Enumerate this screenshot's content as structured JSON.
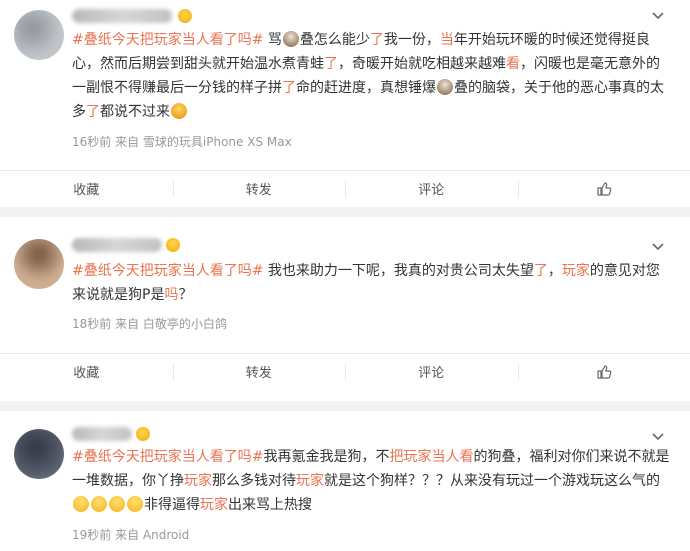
{
  "posts": [
    {
      "content_parts": [
        {
          "t": "#叠纸今天把玩家当人看了吗#",
          "hl": true
        },
        {
          "t": " 骂",
          "hl": false
        },
        {
          "emoji": "face"
        },
        {
          "t": "叠怎么能少",
          "hl": false
        },
        {
          "t": "了",
          "hl": true
        },
        {
          "t": "我一份，",
          "hl": false
        },
        {
          "t": "当",
          "hl": true
        },
        {
          "t": "年开始玩环暖的时候还觉得挺良心，然而后期尝到甜头就开始温水煮青蛙",
          "hl": false
        },
        {
          "t": "了",
          "hl": true
        },
        {
          "t": "，奇暖开始就吃相越来越难",
          "hl": false
        },
        {
          "t": "看",
          "hl": true
        },
        {
          "t": "，闪暖也是毫无意外的一副恨不得赚最后一分钱的样子拼",
          "hl": false
        },
        {
          "t": "了",
          "hl": true
        },
        {
          "t": "命的赶进度，真想锤爆",
          "hl": false
        },
        {
          "emoji": "face"
        },
        {
          "t": "叠的脑袋，关于他的恶心事真的太多",
          "hl": false
        },
        {
          "t": "了",
          "hl": true
        },
        {
          "t": "都说不过来",
          "hl": false
        },
        {
          "emoji": "angry"
        }
      ],
      "meta": "16秒前  来自 雪球的玩具iPhone XS Max"
    },
    {
      "content_parts": [
        {
          "t": "#叠纸今天把玩家当人看了吗#",
          "hl": true
        },
        {
          "t": " 我也来助力一下呢，我真的对贵公司太失望",
          "hl": false
        },
        {
          "t": "了",
          "hl": true
        },
        {
          "t": "，",
          "hl": false
        },
        {
          "t": "玩家",
          "hl": true
        },
        {
          "t": "的意见对您来说就是狗P是",
          "hl": false
        },
        {
          "t": "吗",
          "hl": true
        },
        {
          "t": "？",
          "hl": false
        }
      ],
      "meta": "18秒前  来自 白敬亭的小白鸽"
    },
    {
      "content_parts": [
        {
          "t": "#叠纸今天把玩家当人看了吗#",
          "hl": true
        },
        {
          "t": "我再氪金我是狗，不",
          "hl": false
        },
        {
          "t": "把玩家当人看",
          "hl": true
        },
        {
          "t": "的狗叠，福利对你们来说不就是一堆数据，你丫挣",
          "hl": false
        },
        {
          "t": "玩家",
          "hl": true
        },
        {
          "t": "那么多钱对待",
          "hl": false
        },
        {
          "t": "玩家",
          "hl": true
        },
        {
          "t": "就是这个狗样？？？从来没有玩过一个游戏玩这么气的",
          "hl": false
        },
        {
          "emoji": "smile"
        },
        {
          "emoji": "smile"
        },
        {
          "emoji": "smile"
        },
        {
          "emoji": "smile"
        },
        {
          "t": "非得逼得",
          "hl": false
        },
        {
          "t": "玩家",
          "hl": true
        },
        {
          "t": "出来骂上热搜",
          "hl": false
        }
      ],
      "meta": "19秒前  来自 Android"
    }
  ],
  "actions": {
    "collect": "收藏",
    "repost": "转发",
    "comment": "评论"
  },
  "colors": {
    "highlight": "#eb7350",
    "meta": "#999999",
    "gap": "#f2f2f2"
  }
}
